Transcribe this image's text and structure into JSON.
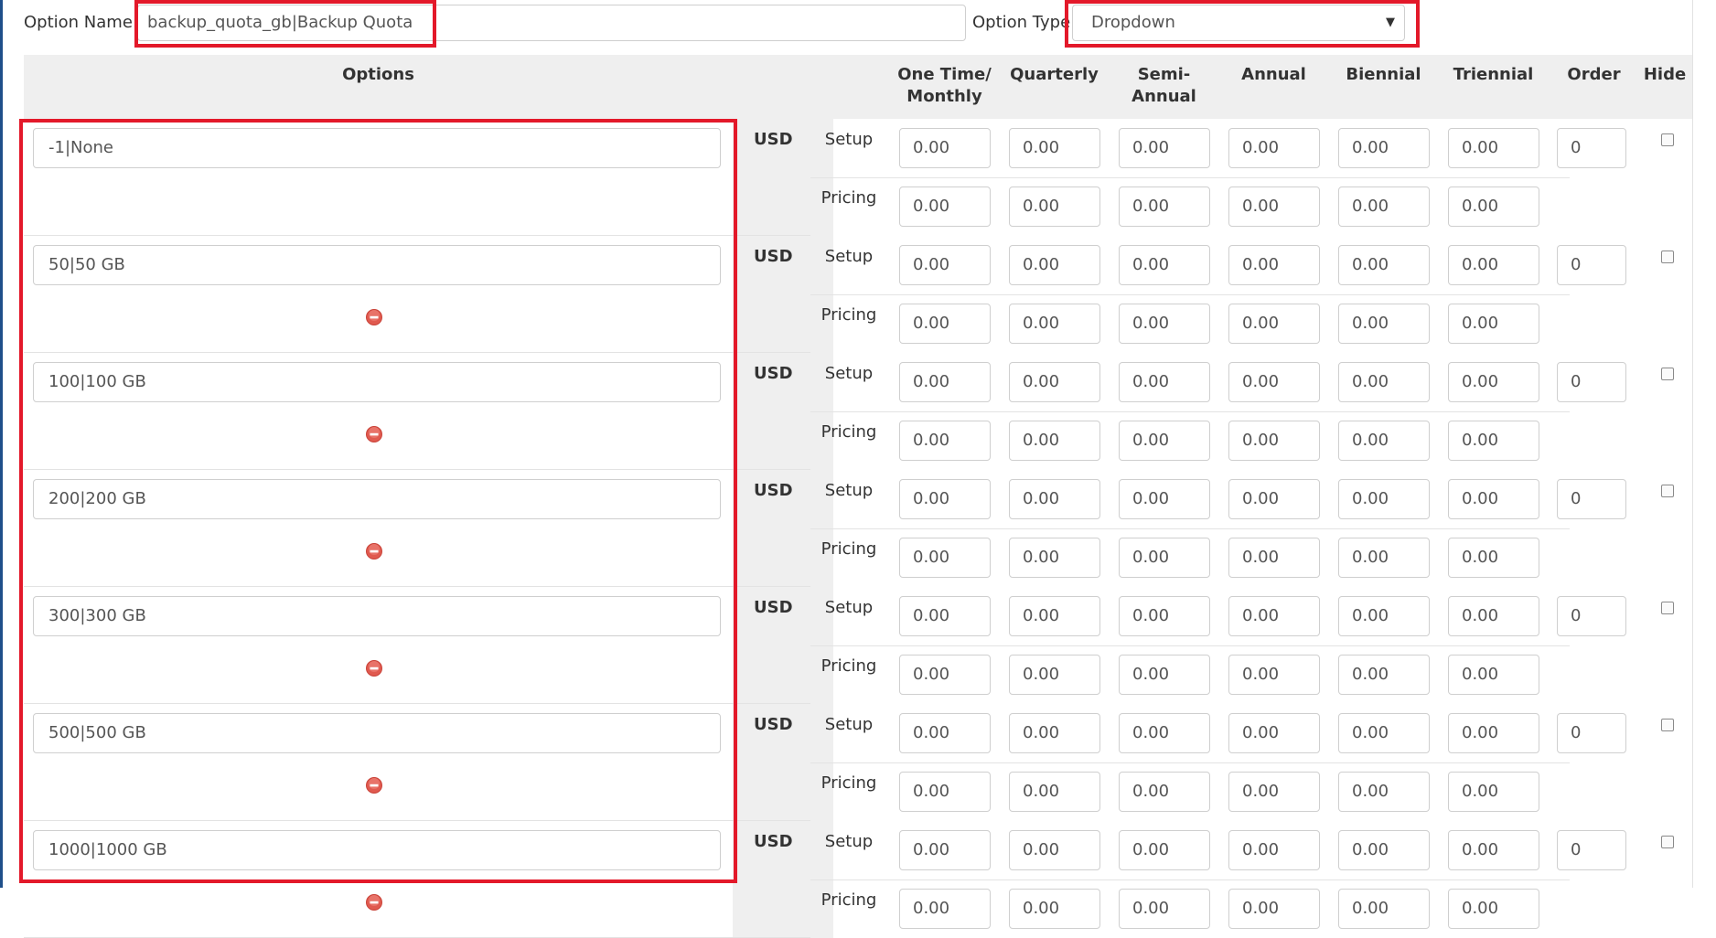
{
  "option_name": {
    "label": "Option Name:",
    "value": "backup_quota_gb|Backup Quota"
  },
  "option_type": {
    "label": "Option Type",
    "value": "Dropdown",
    "caret": "▼"
  },
  "headers": {
    "options": "Options",
    "one_time_a": "One Time/",
    "one_time_b": "Monthly",
    "quarterly": "Quarterly",
    "semi_a": "Semi-",
    "semi_b": "Annual",
    "annual": "Annual",
    "biennial": "Biennial",
    "triennial": "Triennial",
    "order": "Order",
    "hide": "Hide"
  },
  "labels": {
    "currency": "USD",
    "setup": "Setup",
    "pricing": "Pricing"
  },
  "rows": [
    {
      "value": "-1|None",
      "order": "0",
      "removable": false,
      "setup": [
        "0.00",
        "0.00",
        "0.00",
        "0.00",
        "0.00",
        "0.00"
      ],
      "pricing": [
        "0.00",
        "0.00",
        "0.00",
        "0.00",
        "0.00",
        "0.00"
      ]
    },
    {
      "value": "50|50 GB",
      "order": "0",
      "removable": true,
      "setup": [
        "0.00",
        "0.00",
        "0.00",
        "0.00",
        "0.00",
        "0.00"
      ],
      "pricing": [
        "0.00",
        "0.00",
        "0.00",
        "0.00",
        "0.00",
        "0.00"
      ]
    },
    {
      "value": "100|100 GB",
      "order": "0",
      "removable": true,
      "setup": [
        "0.00",
        "0.00",
        "0.00",
        "0.00",
        "0.00",
        "0.00"
      ],
      "pricing": [
        "0.00",
        "0.00",
        "0.00",
        "0.00",
        "0.00",
        "0.00"
      ]
    },
    {
      "value": "200|200 GB",
      "order": "0",
      "removable": true,
      "setup": [
        "0.00",
        "0.00",
        "0.00",
        "0.00",
        "0.00",
        "0.00"
      ],
      "pricing": [
        "0.00",
        "0.00",
        "0.00",
        "0.00",
        "0.00",
        "0.00"
      ]
    },
    {
      "value": "300|300 GB",
      "order": "0",
      "removable": true,
      "setup": [
        "0.00",
        "0.00",
        "0.00",
        "0.00",
        "0.00",
        "0.00"
      ],
      "pricing": [
        "0.00",
        "0.00",
        "0.00",
        "0.00",
        "0.00",
        "0.00"
      ]
    },
    {
      "value": "500|500 GB",
      "order": "0",
      "removable": true,
      "setup": [
        "0.00",
        "0.00",
        "0.00",
        "0.00",
        "0.00",
        "0.00"
      ],
      "pricing": [
        "0.00",
        "0.00",
        "0.00",
        "0.00",
        "0.00",
        "0.00"
      ]
    },
    {
      "value": "1000|1000 GB",
      "order": "0",
      "removable": true,
      "setup": [
        "0.00",
        "0.00",
        "0.00",
        "0.00",
        "0.00",
        "0.00"
      ],
      "pricing": [
        "0.00",
        "0.00",
        "0.00",
        "0.00",
        "0.00",
        "0.00"
      ]
    }
  ],
  "colors": {
    "highlight": "#e3192a",
    "header_bg": "#efefef",
    "left_bar": "#1f4f8a",
    "remove_icon": "#e05a4f"
  },
  "icons": {
    "remove": "minus-circle-icon",
    "hide": "checkbox"
  }
}
